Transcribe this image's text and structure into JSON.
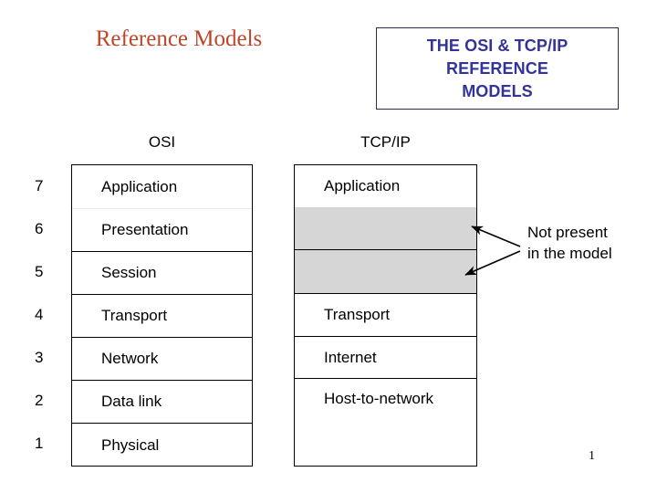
{
  "slide": {
    "title": "Reference Models",
    "title_color": "#bf4528",
    "page_number": "1"
  },
  "title_box": {
    "line1": "THE OSI & TCP/IP",
    "line2": "REFERENCE",
    "line3": "MODELS",
    "text_color": "#333399",
    "border_color": "#2b2b55"
  },
  "columns": {
    "osi_caption": "OSI",
    "tcpip_caption": "TCP/IP"
  },
  "osi": {
    "layer_numbers": [
      "7",
      "6",
      "5",
      "4",
      "3",
      "2",
      "1"
    ],
    "layers": [
      "Application",
      "Presentation",
      "Session",
      "Transport",
      "Network",
      "Data link",
      "Physical"
    ]
  },
  "tcpip": {
    "shade_color": "#d6d6d6",
    "layers": [
      {
        "label": "Application",
        "shaded": false
      },
      {
        "label": "",
        "shaded": true
      },
      {
        "label": "",
        "shaded": true
      },
      {
        "label": "Transport",
        "shaded": false
      },
      {
        "label": "Internet",
        "shaded": false
      },
      {
        "label": "Host-to-network",
        "shaded": false
      }
    ]
  },
  "annotation": {
    "line1": "Not present",
    "line2": "in the model"
  }
}
